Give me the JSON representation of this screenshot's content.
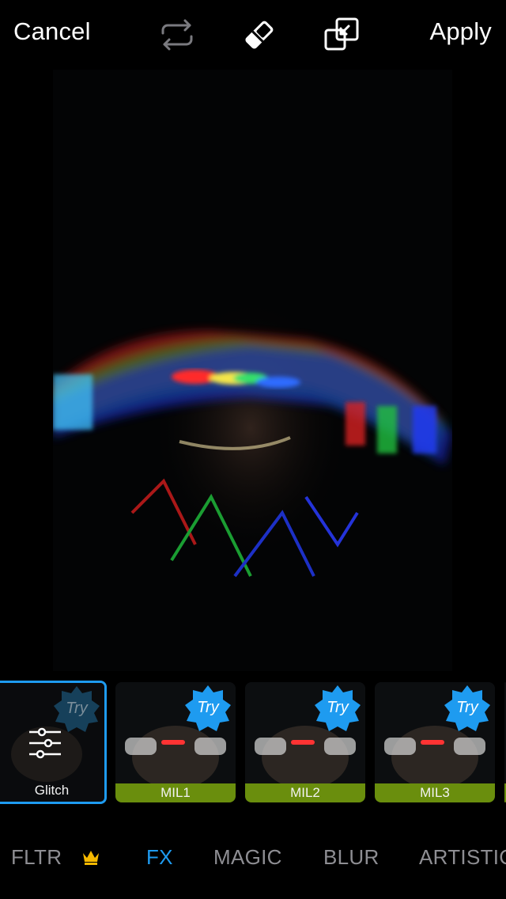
{
  "header": {
    "cancel_label": "Cancel",
    "apply_label": "Apply",
    "icons": [
      "swap-icon",
      "eraser-icon",
      "compare-icon"
    ]
  },
  "effects": [
    {
      "label": "Glitch",
      "badge": "Try",
      "selected": true
    },
    {
      "label": "MIL1",
      "badge": "Try",
      "selected": false
    },
    {
      "label": "MIL2",
      "badge": "Try",
      "selected": false
    },
    {
      "label": "MIL3",
      "badge": "Try",
      "selected": false
    }
  ],
  "tabs": [
    {
      "label": "FLTR",
      "premium": true
    },
    {
      "label": "FX",
      "active": true
    },
    {
      "label": "MAGIC"
    },
    {
      "label": "BLUR"
    },
    {
      "label": "ARTISTIC"
    }
  ],
  "colors": {
    "accent": "#1e9bf0",
    "caption_bar": "#6a8e0d",
    "badge": "#1e9bf0",
    "crown": "#f5b800"
  }
}
